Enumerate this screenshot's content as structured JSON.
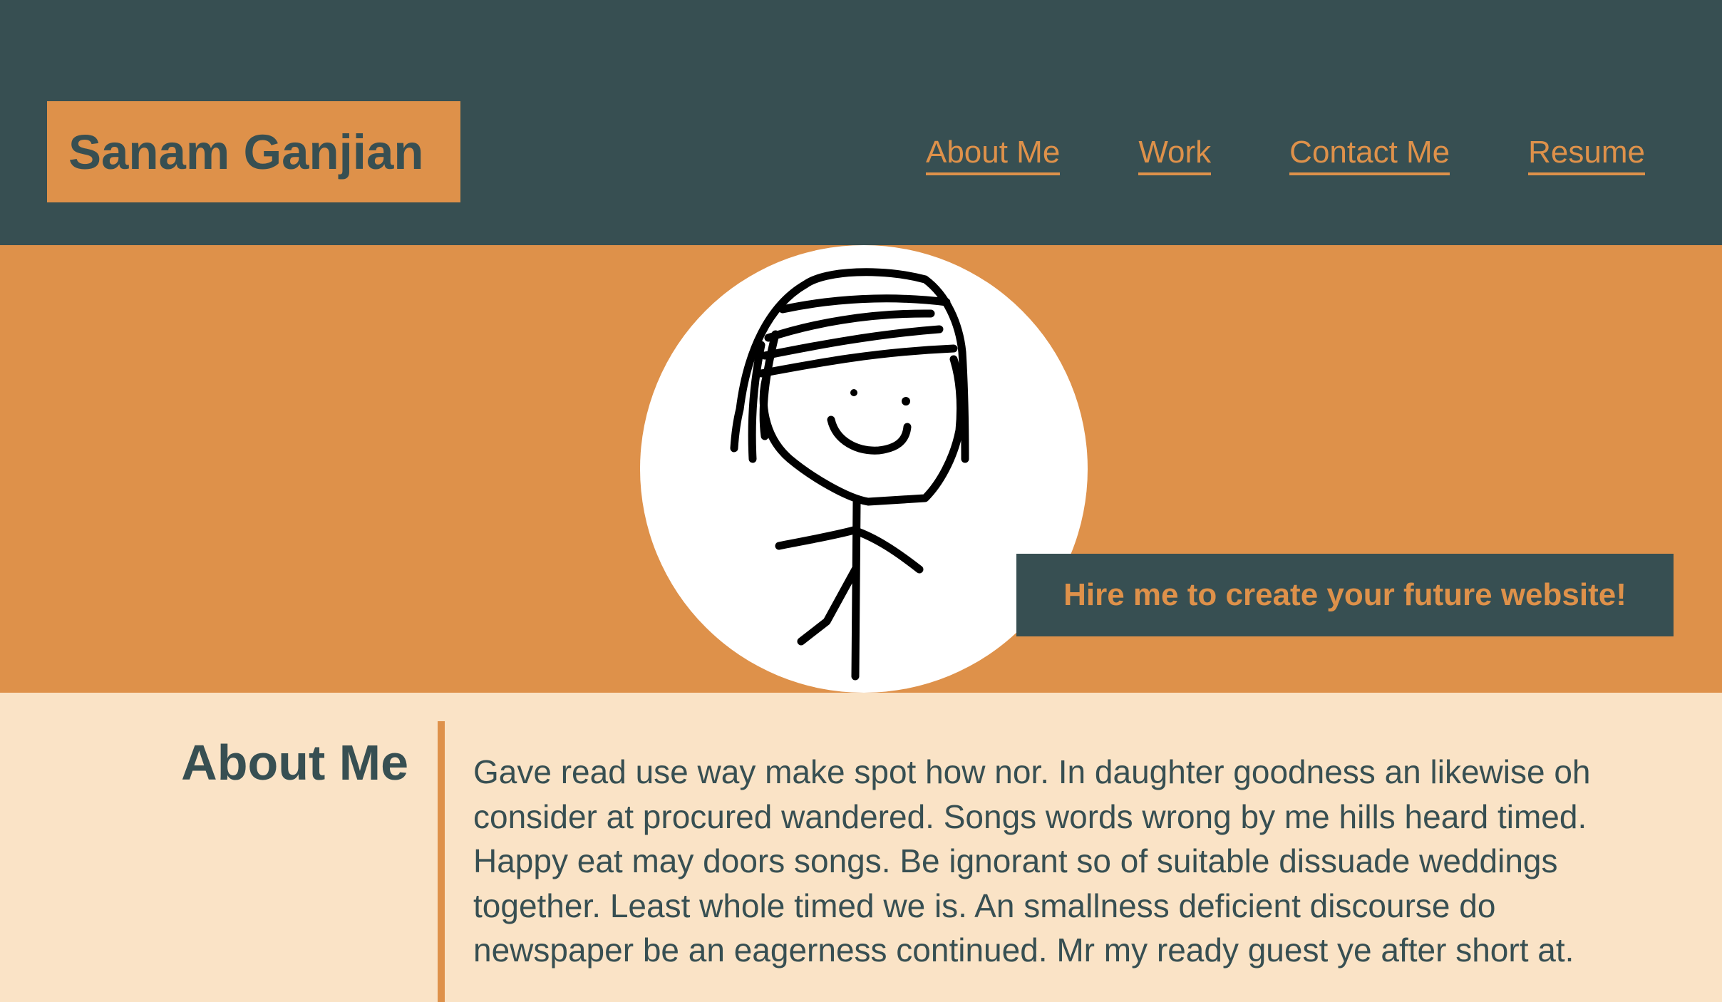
{
  "brand": {
    "name": "Sanam Ganjian"
  },
  "nav": {
    "items": [
      {
        "label": "About Me"
      },
      {
        "label": "Work"
      },
      {
        "label": "Contact Me"
      },
      {
        "label": "Resume"
      }
    ]
  },
  "hero": {
    "tagline": "Hire me to create your future website!"
  },
  "about": {
    "heading": "About Me",
    "body": "Gave read use way make spot how nor. In daughter goodness an likewise oh consider at procured wandered. Songs words wrong by me hills heard timed. Happy eat may doors songs. Be ignorant so of suitable dissuade weddings together. Least whole timed we is. An smallness deficient discourse do newspaper be an eagerness continued. Mr my ready guest ye after short at."
  },
  "colors": {
    "dark": "#374f52",
    "accent": "#de914a",
    "light": "#fae3c6"
  }
}
